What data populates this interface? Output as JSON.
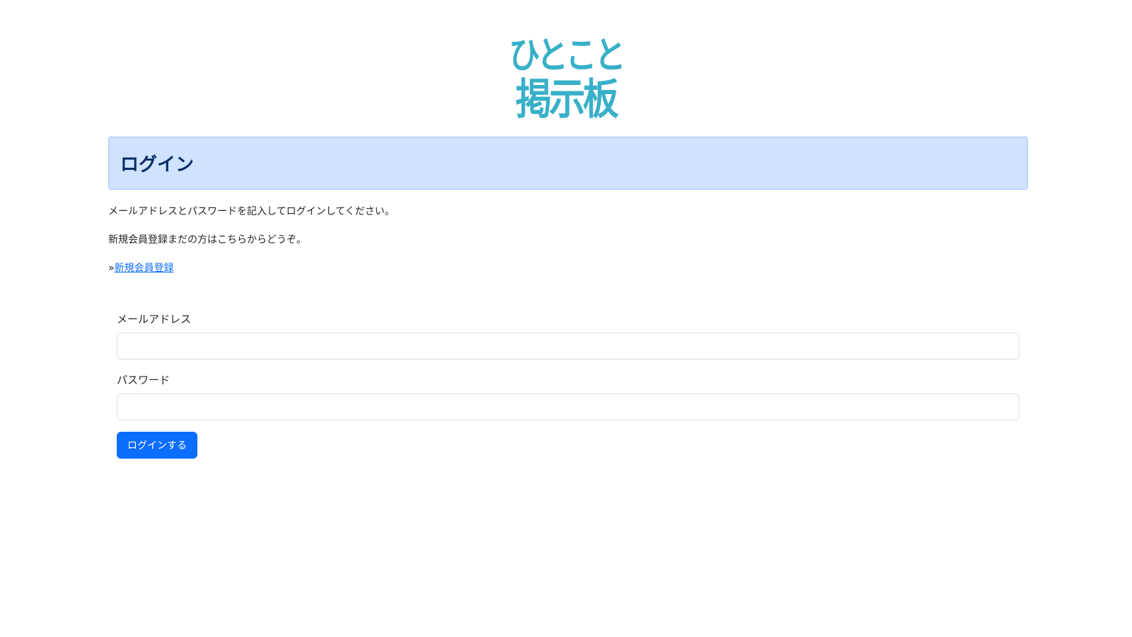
{
  "logo": {
    "line1": "ひとこと",
    "line2": "掲示板",
    "color": "#38b0c9"
  },
  "header": {
    "title": "ログイン"
  },
  "intro": {
    "line1": "メールアドレスとパスワードを記入してログインしてください。",
    "line2": "新規会員登録まだの方はこちらからどうぞ。",
    "link_prefix": "»",
    "link_label": "新規会員登録"
  },
  "form": {
    "email_label": "メールアドレス",
    "email_value": "",
    "password_label": "パスワード",
    "password_value": "",
    "submit_label": "ログインする"
  },
  "colors": {
    "primary": "#0d6efd",
    "header_bg": "#cfe2ff",
    "header_border": "#9ec5fe",
    "header_text": "#052c65"
  }
}
